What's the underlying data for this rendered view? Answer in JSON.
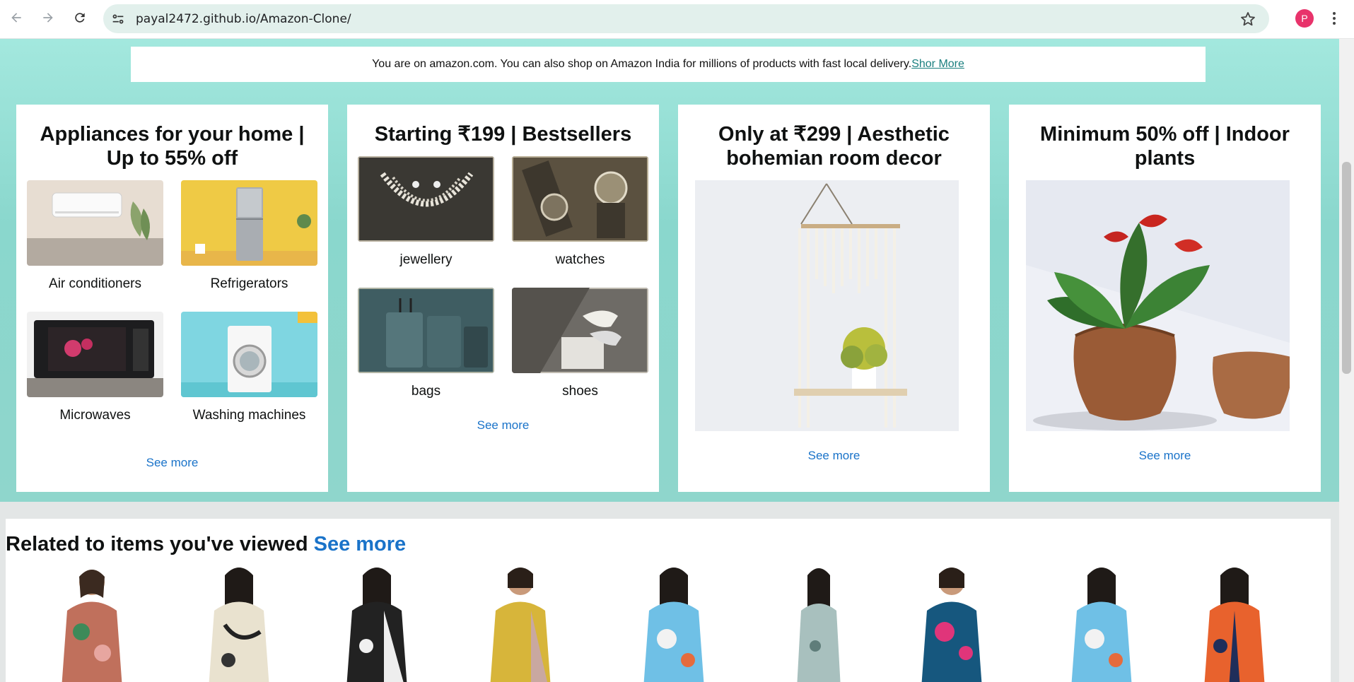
{
  "browser": {
    "url": "payal2472.github.io/Amazon-Clone/",
    "avatar_letter": "P",
    "avatar_color": "#e8336b"
  },
  "notice": {
    "text": "You are on amazon.com. You can also shop on Amazon India for millions of products with fast local delivery.",
    "link": "Shor More"
  },
  "cards": [
    {
      "title": "Appliances for your home | Up to 55% off",
      "items": [
        "Air conditioners",
        "Refrigerators",
        "Microwaves",
        "Washing machines"
      ],
      "see_more": "See more"
    },
    {
      "title": "Starting ₹199 | Bestsellers",
      "items": [
        "jewellery",
        "watches",
        "bags",
        "shoes"
      ],
      "see_more": "See more"
    },
    {
      "title": "Only at ₹299 | Aesthetic bohemian room decor",
      "see_more": "See more"
    },
    {
      "title": "Minimum 50% off | Indoor plants",
      "see_more": "See more"
    }
  ],
  "related": {
    "title": "Related to items you've viewed",
    "link": "See more"
  },
  "colors": {
    "hero_bg": "#8ad7cd",
    "link": "#1a73c9"
  }
}
